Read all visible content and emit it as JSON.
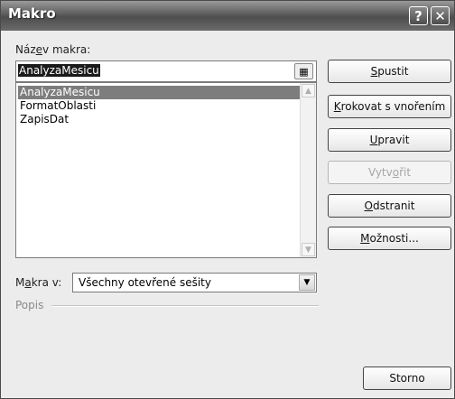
{
  "window": {
    "title": "Makro",
    "help_glyph": "?",
    "close_glyph": "✕"
  },
  "macro_name": {
    "label_pre": "Náz",
    "label_key": "e",
    "label_post": "v makra:",
    "value": "AnalyzaMesicu"
  },
  "macro_list": {
    "items": [
      "AnalyzaMesicu",
      "FormatOblasti",
      "ZapisDat"
    ],
    "selected_index": 0
  },
  "buttons": {
    "run": {
      "key": "S",
      "rest": "pustit"
    },
    "step_into": {
      "key": "K",
      "rest": "rokovat s vnořením"
    },
    "edit": {
      "key": "U",
      "rest": "pravit"
    },
    "create": {
      "pre": "Vytv",
      "key": "o",
      "post": "řit",
      "disabled": true
    },
    "delete": {
      "key": "O",
      "rest": "dstranit"
    },
    "options": {
      "key": "M",
      "rest": "ožnosti..."
    },
    "cancel": {
      "label": "Storno"
    }
  },
  "macros_in": {
    "label_pre": "M",
    "label_key": "a",
    "label_post": "kra v:",
    "selected": "Všechny otevřené sešity"
  },
  "description": {
    "label": "Popis"
  },
  "icons": {
    "picker": "range-picker-icon",
    "scroll_up": "up-arrow-icon",
    "scroll_down": "down-arrow-icon",
    "dropdown": "chevron-down-icon"
  },
  "colors": {
    "title_bar": "#5c5c5c",
    "selection": "#7d7d7d"
  }
}
